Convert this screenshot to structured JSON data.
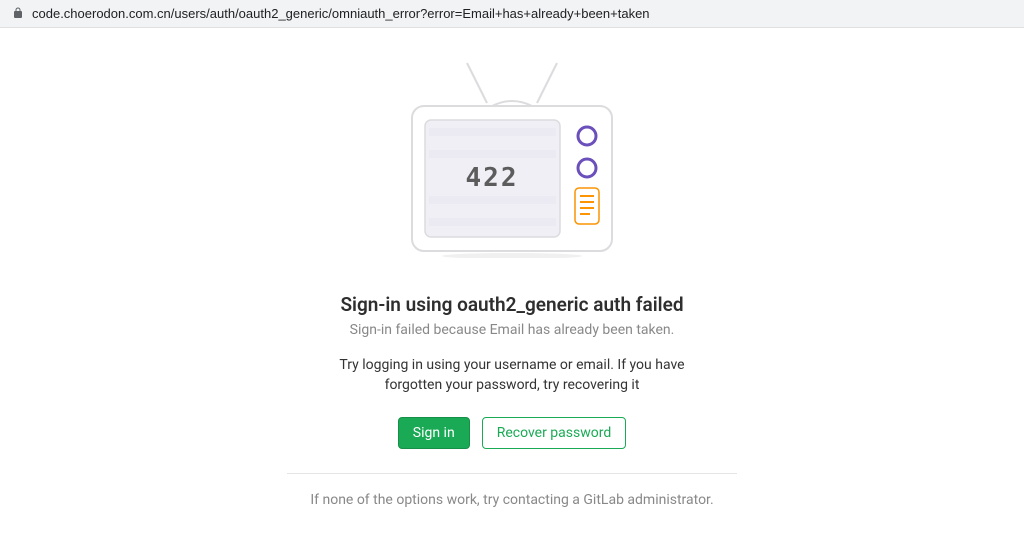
{
  "address_bar": {
    "url": "code.choerodon.com.cn/users/auth/oauth2_generic/omniauth_error?error=Email+has+already+been+taken"
  },
  "illustration": {
    "error_code": "422"
  },
  "error": {
    "heading": "Sign-in using oauth2_generic auth failed",
    "subtitle": "Sign-in failed because Email has already been taken.",
    "help_text": "Try logging in using your username or email. If you have forgotten your password, try recovering it"
  },
  "buttons": {
    "sign_in": "Sign in",
    "recover_password": "Recover password"
  },
  "footer": {
    "text": "If none of the options work, try contacting a GitLab administrator."
  }
}
